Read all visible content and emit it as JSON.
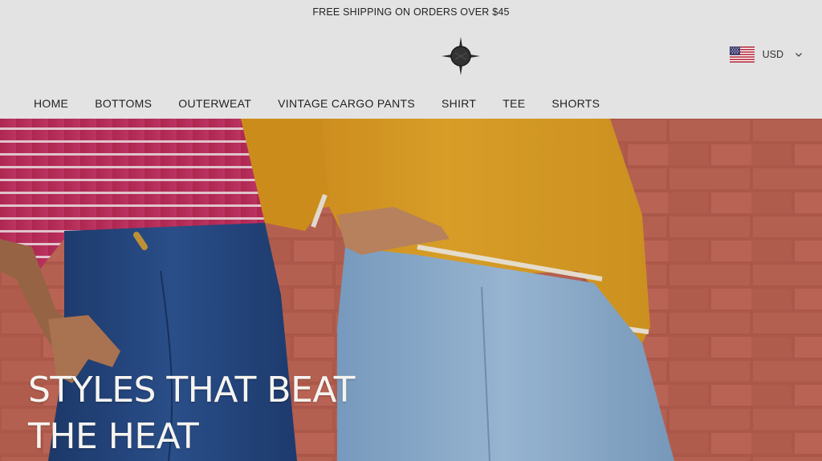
{
  "announcement": {
    "text": "FREE SHIPPING ON ORDERS OVER $45"
  },
  "currency": {
    "label": "USD",
    "flag_icon": "us-flag-icon",
    "dropdown_icon": "chevron-down-icon"
  },
  "logo": {
    "icon": "compass-star-logo"
  },
  "nav": {
    "items": [
      {
        "label": "HOME"
      },
      {
        "label": "BOTTOMS"
      },
      {
        "label": "OUTERWEAT"
      },
      {
        "label": "VINTAGE CARGO PANTS"
      },
      {
        "label": "SHIRT"
      },
      {
        "label": "TEE"
      },
      {
        "label": "SHORTS"
      }
    ]
  },
  "hero": {
    "title_line1": "STYLES THAT BEAT",
    "title_line2": "THE HEAT"
  },
  "colors": {
    "background": "#e3e3e3",
    "brick": "#b85e4f",
    "pink_shirt": "#c2315f",
    "yellow_sweater": "#e1a325",
    "dark_denim": "#25477e",
    "light_denim": "#8eb1d3"
  }
}
